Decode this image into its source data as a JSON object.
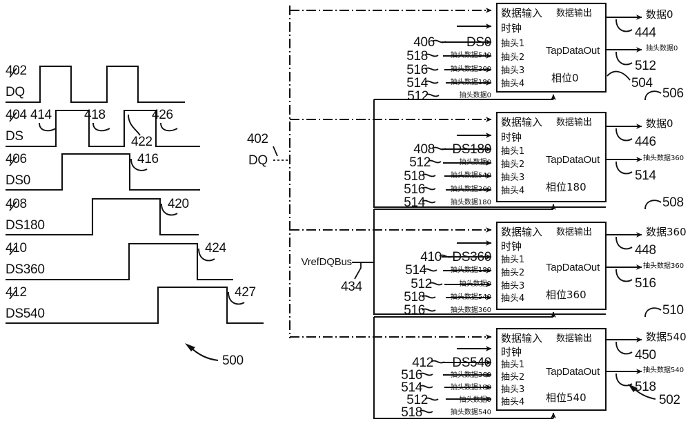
{
  "figure": {
    "waveform_ref": "500",
    "block_ref": "502"
  },
  "waveforms": {
    "rows": [
      {
        "ref": "402",
        "name": "DQ"
      },
      {
        "ref": "404",
        "name": "DS"
      },
      {
        "ref": "406",
        "name": "DS0"
      },
      {
        "ref": "408",
        "name": "DS180"
      },
      {
        "ref": "410",
        "name": "DS360"
      },
      {
        "ref": "412",
        "name": "DS540"
      }
    ],
    "callouts": [
      "414",
      "418",
      "426",
      "422",
      "416",
      "420",
      "424",
      "427"
    ]
  },
  "bus": {
    "dq_ref": "402",
    "dq_label": "DQ",
    "vref_label": "VrefDQBus",
    "vref_ref": "434"
  },
  "blocks": [
    {
      "ref": "504",
      "outer_ref": "506",
      "clock_ref": "406",
      "clock_label": "DS0",
      "in_port_data": "数据输入",
      "in_port_clock": "时钟",
      "out_port_data": "数据输出",
      "out_port_tap": "TapDataOut",
      "phase": "相位0",
      "taps": [
        {
          "port": "抽头1",
          "ref": "518",
          "label": "抽头数据540"
        },
        {
          "port": "抽头2",
          "ref": "516",
          "label": "抽头数据360"
        },
        {
          "port": "抽头3",
          "ref": "514",
          "label": "抽头数据180"
        },
        {
          "port": "抽头4",
          "ref": "512",
          "label": "抽头数据0"
        }
      ],
      "out_data_label": "数据0",
      "out_data_ref": "444",
      "out_tap_label": "抽头数据0",
      "out_tap_ref": "512"
    },
    {
      "ref": "506",
      "outer_ref": "508",
      "clock_ref": "408",
      "clock_label": "DS180",
      "in_port_data": "数据输入",
      "in_port_clock": "时钟",
      "out_port_data": "数据输出",
      "out_port_tap": "TapDataOut",
      "phase": "相位180",
      "taps": [
        {
          "port": "抽头1",
          "ref": "512",
          "label": "抽头数据0"
        },
        {
          "port": "抽头2",
          "ref": "518",
          "label": "抽头数据540"
        },
        {
          "port": "抽头3",
          "ref": "516",
          "label": "抽头数据360"
        },
        {
          "port": "抽头4",
          "ref": "514",
          "label": "抽头数据180"
        }
      ],
      "out_data_label": "数据0",
      "out_data_ref": "446",
      "out_tap_label": "抽头数据360",
      "out_tap_ref": "514"
    },
    {
      "ref": "508",
      "outer_ref": "510",
      "clock_ref": "410",
      "clock_label": "DS360",
      "in_port_data": "数据输入",
      "in_port_clock": "时钟",
      "out_port_data": "数据输出",
      "out_port_tap": "TapDataOut",
      "phase": "相位360",
      "taps": [
        {
          "port": "抽头1",
          "ref": "514",
          "label": "抽头数据180"
        },
        {
          "port": "抽头2",
          "ref": "512",
          "label": "抽头数据0"
        },
        {
          "port": "抽头3",
          "ref": "518",
          "label": "抽头数据540"
        },
        {
          "port": "抽头4",
          "ref": "516",
          "label": "抽头数据360"
        }
      ],
      "out_data_label": "数据360",
      "out_data_ref": "448",
      "out_tap_label": "抽头数据360",
      "out_tap_ref": "516"
    },
    {
      "ref": "510",
      "outer_ref": "",
      "clock_ref": "412",
      "clock_label": "DS540",
      "in_port_data": "数据输入",
      "in_port_clock": "时钟",
      "out_port_data": "数据输出",
      "out_port_tap": "TapDataOut",
      "phase": "相位540",
      "taps": [
        {
          "port": "抽头1",
          "ref": "516",
          "label": "抽头数据360"
        },
        {
          "port": "抽头2",
          "ref": "514",
          "label": "抽头数据180"
        },
        {
          "port": "抽头3",
          "ref": "512",
          "label": "抽头数据0"
        },
        {
          "port": "抽头4",
          "ref": "518",
          "label": "抽头数据540"
        }
      ],
      "out_data_label": "数据540",
      "out_data_ref": "450",
      "out_tap_label": "抽头数据540",
      "out_tap_ref": "518"
    }
  ]
}
